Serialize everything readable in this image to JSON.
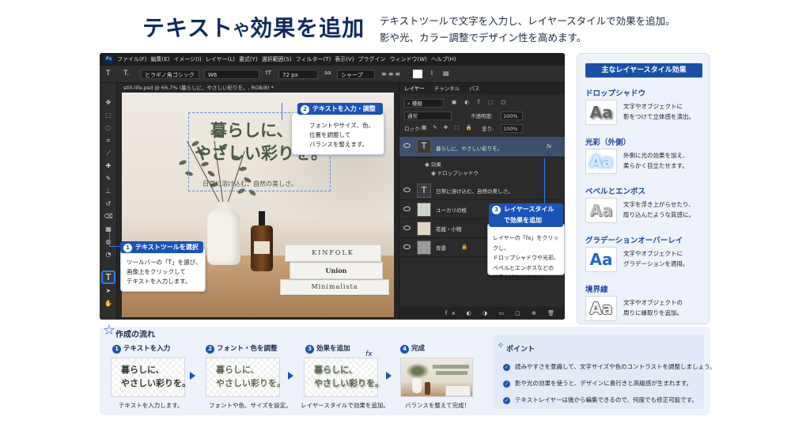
{
  "header": {
    "title_main": "テキスト",
    "title_mid": "や",
    "title_end": "効果を追加",
    "subtitle_lines": [
      "テキストツールで文字を入力し、レイヤースタイルで効果を追加。",
      "影や光、カラー調整でデザイン性を高めます。"
    ]
  },
  "ps": {
    "logo": "Ps",
    "menu": [
      "ファイル(F)",
      "編集(E)",
      "イメージ(I)",
      "レイヤー(L)",
      "書式(Y)",
      "選択範囲(S)",
      "フィルター(T)",
      "表示(V)",
      "プラグイン",
      "ウィンドウ(W)",
      "ヘルプ(H)"
    ],
    "options": {
      "tool_t1": "T",
      "tool_t2": "T.",
      "font": "ヒラギノ角ゴシック",
      "weight": "W6",
      "size_icon": "tT",
      "size": "72 px",
      "aa_icon": "aa",
      "aa": "シャープ"
    },
    "doc_tab": "still-life.psd @ 66.7% (暮らしに、やさしい彩りを。, RGB/8) *",
    "canvas": {
      "headline_1": "暮らしに、",
      "headline_2": "やさしい彩りを。",
      "subline": "日常に溶け込む、自然の美しさ。",
      "book1": "KINFOLK",
      "book2": "Union",
      "book3": "Minimalista"
    },
    "panel": {
      "tabs": [
        "レイヤー",
        "チャンネル",
        "パス"
      ],
      "kind": "種類",
      "blend": "通常",
      "opacity_label": "不透明度:",
      "opacity": "100%",
      "lock": "ロック:",
      "fill_label": "塗り:",
      "fill": "100%",
      "layers": [
        {
          "name": "暮らしに、やさしい彩りを。",
          "fx": "fx"
        },
        {
          "name": "日常に溶け込む、自然の美しさ。"
        },
        {
          "name": "ユーカリの枝"
        },
        {
          "name": "花瓶・小物"
        },
        {
          "name": "背景"
        }
      ],
      "effect_label": "効果",
      "effect_item": "ドロップシャドウ",
      "bottom_icons": "fx ◐ ◑ ▭ ▢ ⊕ 🗑"
    }
  },
  "callouts": {
    "c1": {
      "num": "1",
      "title": "テキストツールを選択",
      "body": [
        "ツールバーの「T」を選び、",
        "画像上をクリックして",
        "テキストを入力します。"
      ]
    },
    "c2": {
      "num": "2",
      "title": "テキストを入力・調整",
      "body": [
        "フォントやサイズ、色、",
        "位置を調整して",
        "バランスを整えます。"
      ]
    },
    "c3": {
      "num": "3",
      "title_1": "レイヤースタイル",
      "title_2": "で効果を追加",
      "body": [
        "レイヤーの「fx」をクリックし、",
        "ドロップシャドウや光彩、",
        "ベベルとエンボスなどの",
        "効果を追加します。"
      ]
    }
  },
  "effects": {
    "title": "主なレイヤースタイル効果",
    "items": [
      {
        "name": "ドロップシャドウ",
        "sample": "Aa",
        "desc": [
          "文字やオブジェクトに",
          "影をつけて立体感を演出。"
        ]
      },
      {
        "name": "光彩（外側）",
        "sample": "Aa",
        "desc": [
          "外側に光の効果を加え、",
          "柔らかく目立たせます。"
        ]
      },
      {
        "name": "ベベルとエンボス",
        "sample": "Aa",
        "desc": [
          "文字を浮き上がらせたり、",
          "彫り込んだような質感に。"
        ]
      },
      {
        "name": "グラデーションオーバーレイ",
        "sample": "Aa",
        "desc": [
          "文字やオブジェクトに",
          "グラデーションを適用。"
        ]
      },
      {
        "name": "境界線",
        "sample": "Aa",
        "desc": [
          "文字やオブジェクトの",
          "周りに縁取りを追加。"
        ]
      }
    ]
  },
  "flow": {
    "title": "作成の流れ",
    "steps": [
      {
        "num": "1",
        "title": "テキストを入力",
        "caption": "テキストを入力します。",
        "line1": "暮らしに、",
        "line2": "やさしい彩りを。"
      },
      {
        "num": "2",
        "title": "フォント・色を調整",
        "caption": "フォントや色、サイズを設定。",
        "line1": "暮らしに、",
        "line2": "やさしい彩りを。"
      },
      {
        "num": "3",
        "title": "効果を追加",
        "caption": "レイヤースタイルで効果を追加。",
        "line1": "暮らしに、",
        "line2": "やさしい彩りを。",
        "fx": "fx"
      },
      {
        "num": "4",
        "title": "完成",
        "caption": "バランスを整えて完成！"
      }
    ]
  },
  "points": {
    "title": "ポイント",
    "items": [
      "読みやすさを意識して、文字サイズや色のコントラストを調整しましょう。",
      "影や光の効果を使うと、デザインに奥行きと高級感が生まれます。",
      "テキストレイヤーは後から編集できるので、何度でも修正可能です。"
    ]
  },
  "colors": {
    "accent": "#1b54b6",
    "title": "#0f2a5e",
    "selection": "#3d4f6b"
  }
}
